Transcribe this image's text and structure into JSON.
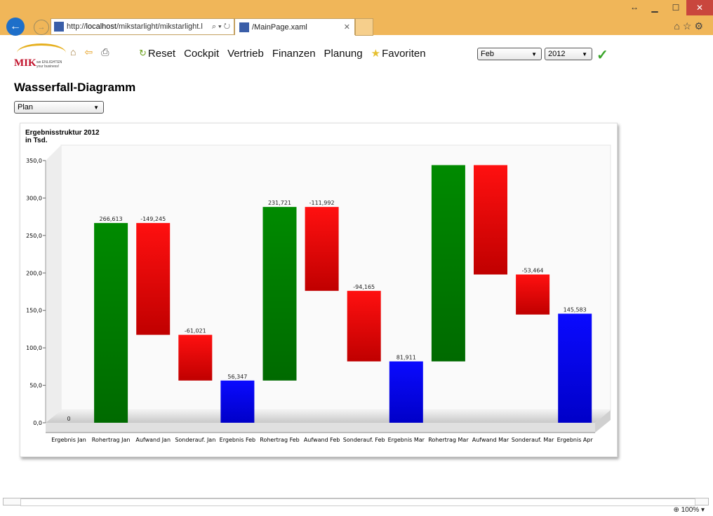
{
  "browser": {
    "url_prefix": "http://",
    "url_host": "localhost",
    "url_rest": "/mikstarlight/mikstarlight.l",
    "tab_title": "/MainPage.xaml",
    "zoom": "100%"
  },
  "toolbar": {
    "menu": [
      "Reset",
      "Cockpit",
      "Vertrieb",
      "Finanzen",
      "Planung",
      "Favoriten"
    ],
    "month": "Feb",
    "year": "2012"
  },
  "page": {
    "title": "Wasserfall-Diagramm",
    "scenario": "Plan"
  },
  "logo": {
    "text": "MIK",
    "tagline_1": "we ENLIGHTEN",
    "tagline_2": "your business!"
  },
  "chart_data": {
    "type": "bar",
    "subtype": "waterfall",
    "title_line1": "Ergebnisstruktur 2012",
    "title_line2": "in Tsd.",
    "ylim": [
      0,
      350
    ],
    "yticks": [
      "0,0",
      "50,0",
      "100,0",
      "150,0",
      "200,0",
      "250,0",
      "300,0",
      "350,0"
    ],
    "colors": {
      "increase": "#008000",
      "decrease": "#e80000",
      "total": "#0000e0"
    },
    "categories": [
      "Ergebnis Jan",
      "Rohertrag Jan",
      "Aufwand Jan",
      "Sonderauf. Jan",
      "Ergebnis Feb",
      "Rohertrag Feb",
      "Aufwand Feb",
      "Sonderauf. Feb",
      "Ergebnis Mar",
      "Rohertrag Mar",
      "Aufwand Mar",
      "Sonderauf. Mar",
      "Ergebnis Apr"
    ],
    "kinds": [
      "total",
      "increase",
      "decrease",
      "decrease",
      "total",
      "increase",
      "decrease",
      "decrease",
      "total",
      "increase",
      "decrease",
      "decrease",
      "total"
    ],
    "values": [
      0,
      266.613,
      -149.245,
      -61.021,
      56.347,
      231.721,
      -111.992,
      -94.165,
      81.911,
      262.0,
      -146.0,
      -53.464,
      145.583
    ],
    "labels": [
      "0",
      "266,613",
      "-149,245",
      "-61,021",
      "56,347",
      "231,721",
      "-111,992",
      "-94,165",
      "81,911",
      "",
      "",
      "-53,464",
      "145,583"
    ]
  }
}
